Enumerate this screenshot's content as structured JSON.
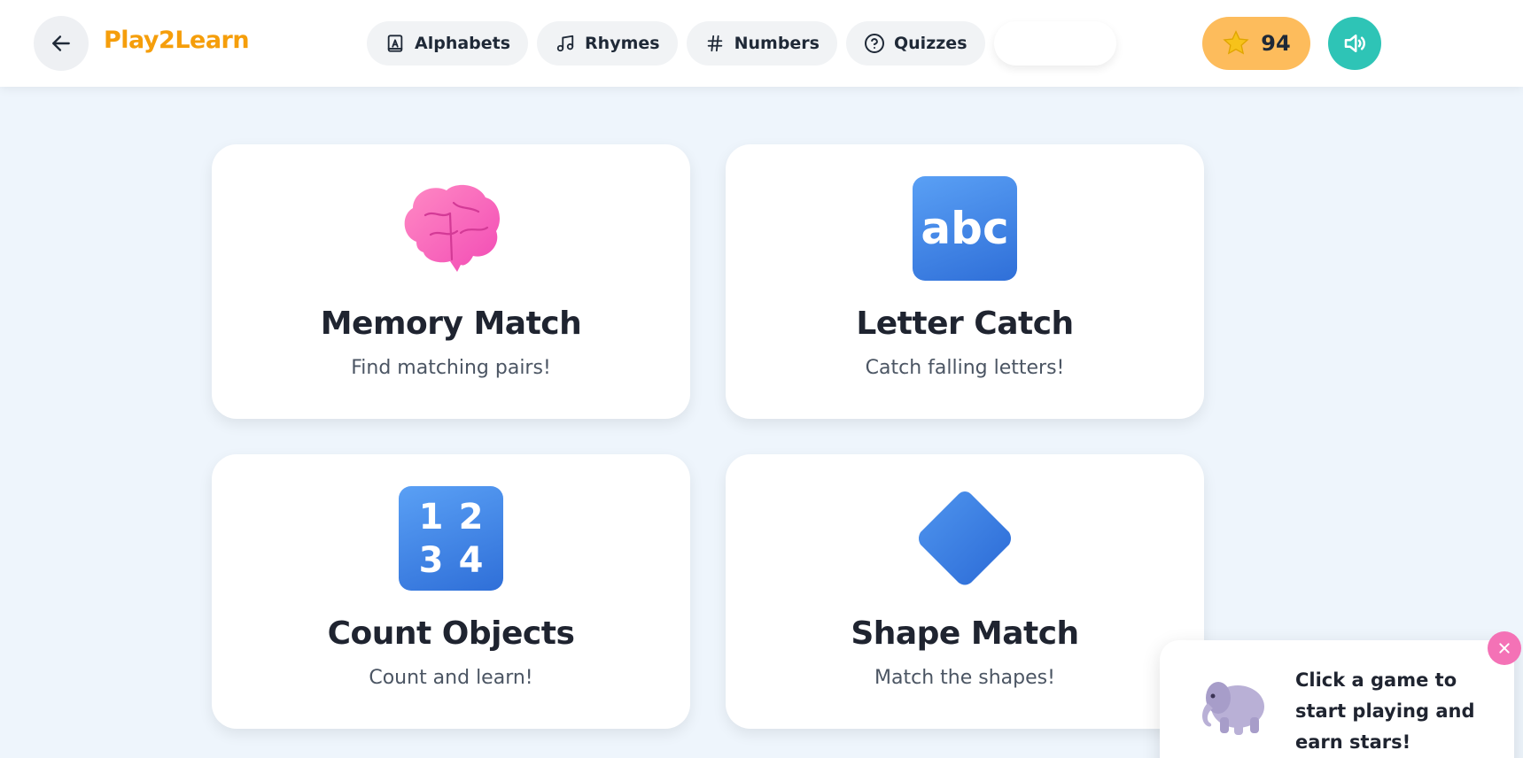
{
  "header": {
    "logo": "Play2Learn",
    "nav": [
      {
        "label": "Alphabets",
        "icon": "alphabet-book-icon"
      },
      {
        "label": "Rhymes",
        "icon": "music-note-icon"
      },
      {
        "label": "Numbers",
        "icon": "hash-icon"
      },
      {
        "label": "Quizzes",
        "icon": "question-circle-icon"
      }
    ],
    "stars": "94"
  },
  "games": [
    {
      "title": "Memory Match",
      "subtitle": "Find matching pairs!",
      "icon": "brain-icon"
    },
    {
      "title": "Letter Catch",
      "subtitle": "Catch falling letters!",
      "icon": "abc-icon"
    },
    {
      "title": "Count Objects",
      "subtitle": "Count and learn!",
      "icon": "numbers-1234-icon"
    },
    {
      "title": "Shape Match",
      "subtitle": "Match the shapes!",
      "icon": "blue-diamond-icon"
    }
  ],
  "tile_text": {
    "abc": "abc",
    "n1": "1",
    "n2": "2",
    "n3": "3",
    "n4": "4"
  },
  "toast": {
    "message": "Click a game to start playing and earn stars!",
    "mascot": "elephant-icon"
  },
  "colors": {
    "logo": "#f59e0b",
    "star_badge": "#fdbc5c",
    "sound_button": "#2ec4b6",
    "close_button": "#f472b6",
    "page_bg": "#eef5fc"
  }
}
